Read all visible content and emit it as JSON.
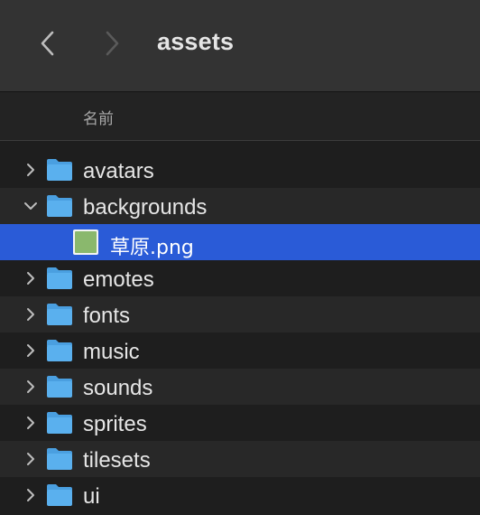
{
  "window": {
    "title": "assets"
  },
  "toolbar": {
    "back_icon": "chevron-left-icon",
    "forward_icon": "chevron-right-icon"
  },
  "column_header": {
    "name_label": "名前"
  },
  "colors": {
    "selection": "#2a5bd7",
    "folder": "#5ab0ee",
    "thumbnail": "#8ab86d"
  },
  "items": [
    {
      "label": "avatars",
      "kind": "folder",
      "expanded": false
    },
    {
      "label": "backgrounds",
      "kind": "folder",
      "expanded": true
    },
    {
      "label": "草原.png",
      "kind": "image-file",
      "selected": true
    },
    {
      "label": "emotes",
      "kind": "folder",
      "expanded": false
    },
    {
      "label": "fonts",
      "kind": "folder",
      "expanded": false
    },
    {
      "label": "music",
      "kind": "folder",
      "expanded": false
    },
    {
      "label": "sounds",
      "kind": "folder",
      "expanded": false
    },
    {
      "label": "sprites",
      "kind": "folder",
      "expanded": false
    },
    {
      "label": "tilesets",
      "kind": "folder",
      "expanded": false
    },
    {
      "label": "ui",
      "kind": "folder",
      "expanded": false
    }
  ]
}
